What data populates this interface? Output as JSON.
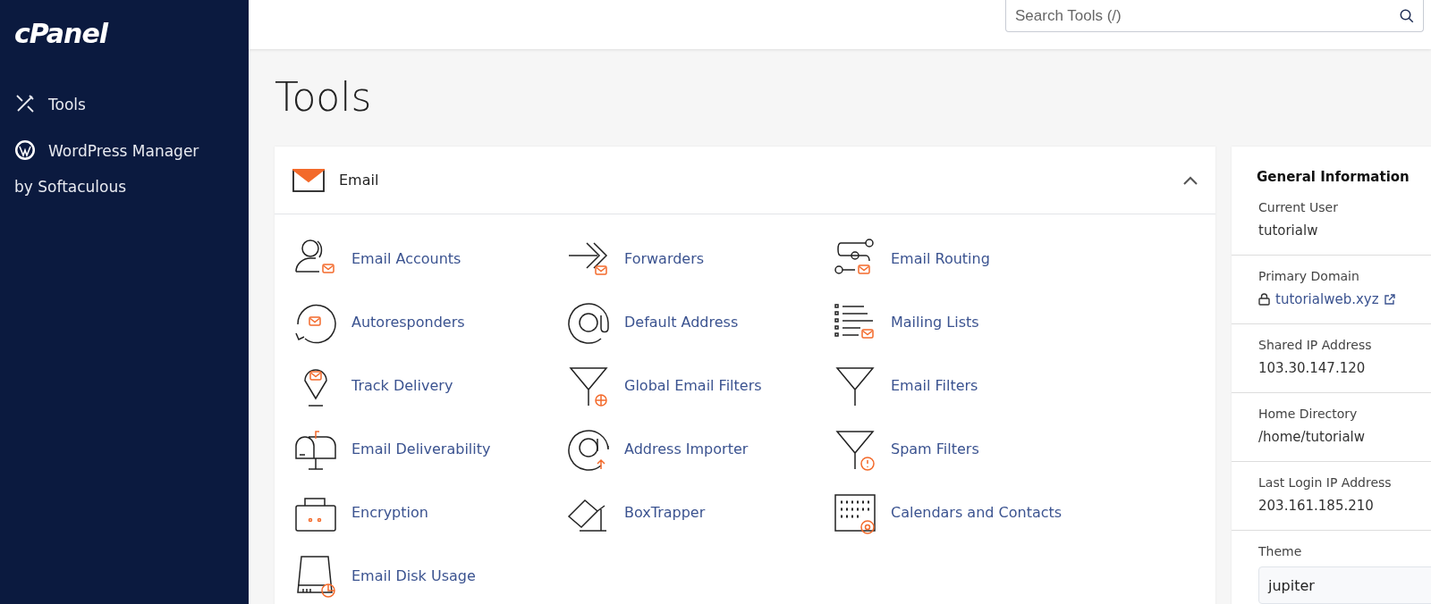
{
  "sidebar": {
    "logo": "cPanel",
    "items": [
      {
        "label": "Tools"
      },
      {
        "label": "WordPress Manager by Softaculous"
      }
    ]
  },
  "header": {
    "search": {
      "placeholder": "Search Tools (/)"
    }
  },
  "page_title": "Tools",
  "section": {
    "title": "Email",
    "expanded": true,
    "tools": [
      {
        "label": "Email Accounts"
      },
      {
        "label": "Forwarders"
      },
      {
        "label": "Email Routing"
      },
      {
        "label": "Autoresponders"
      },
      {
        "label": "Default Address"
      },
      {
        "label": "Mailing Lists"
      },
      {
        "label": "Track Delivery"
      },
      {
        "label": "Global Email Filters"
      },
      {
        "label": "Email Filters"
      },
      {
        "label": "Email Deliverability"
      },
      {
        "label": "Address Importer"
      },
      {
        "label": "Spam Filters"
      },
      {
        "label": "Encryption"
      },
      {
        "label": "BoxTrapper"
      },
      {
        "label": "Calendars and Contacts"
      },
      {
        "label": "Email Disk Usage"
      }
    ]
  },
  "general_information": {
    "title": "General Information",
    "rows": [
      {
        "label": "Current User",
        "value": "tutorialw",
        "kind": "text"
      },
      {
        "label": "Primary Domain",
        "value": "tutorialweb.xyz",
        "kind": "link"
      },
      {
        "label": "Shared IP Address",
        "value": "103.30.147.120",
        "kind": "text"
      },
      {
        "label": "Home Directory",
        "value": "/home/tutorialw",
        "kind": "text"
      },
      {
        "label": "Last Login IP Address",
        "value": "203.161.185.210",
        "kind": "text"
      }
    ],
    "theme": {
      "label": "Theme",
      "value": "jupiter"
    }
  }
}
